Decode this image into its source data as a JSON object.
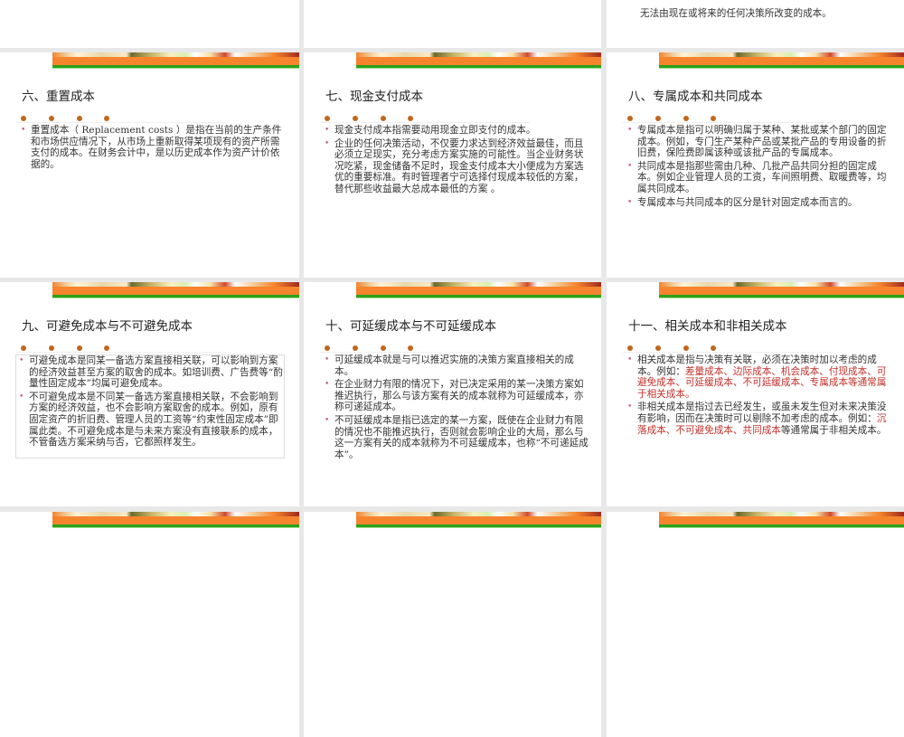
{
  "top_row": {
    "partial_text": "无法由现在或将来的任何决策所改变的成本。"
  },
  "slides": [
    {
      "title": "六、重置成本",
      "boxed": false,
      "bullets": [
        [
          {
            "text": "重置成本（ Replacement costs ）是指在当前的生产条件和市场供应情况下，从市场上重新取得某项现有的资产所需支付的成本。在财务会计中，是以历史成本作为资产计价依据的。",
            "red": false
          }
        ]
      ]
    },
    {
      "title": "七、现金支付成本",
      "boxed": false,
      "bullets": [
        [
          {
            "text": "现金支付成本指需要动用现金立即支付的成本。",
            "red": false
          }
        ],
        [
          {
            "text": "企业的任何决策活动，不仅要力求达到经济效益最佳，而且必须立足现实，充分考虑方案实施的可能性。当企业财务状况吃紧，现金储备不足时，现金支付成本大小便成为方案选优的重要标准。有时管理者宁可选择付现成本较低的方案，替代那些收益最大总成本最低的方案 。",
            "red": false
          }
        ]
      ]
    },
    {
      "title": "八、专属成本和共同成本",
      "boxed": false,
      "bullets": [
        [
          {
            "text": "专属成本是指可以明确归属于某种、某批或某个部门的固定成本。例如，专门生产某种产品或某批产品的专用设备的折旧费，保险费即属该种或该批产品的专属成本。",
            "red": false
          }
        ],
        [
          {
            "text": "共同成本是指那些需由几种、几批产品共同分担的固定成本。例如企业管理人员的工资，车间照明费、取暖费等，均属共同成本。",
            "red": false
          }
        ],
        [
          {
            "text": "专属成本与共同成本的区分是针对固定成本而言的。",
            "red": false
          }
        ]
      ]
    },
    {
      "title": "九、可避免成本与不可避免成本",
      "boxed": true,
      "bullets": [
        [
          {
            "text": "可避免成本是同某一备选方案直接相关联，可以影响到方案的经济效益甚至方案的取舍的成本。如培训费、广告费等“酌量性固定成本”均属可避免成本。",
            "red": false
          }
        ],
        [
          {
            "text": "不可避免成本是不同某一备选方案直接相关联，不会影响到方案的经济效益，也不会影响方案取舍的成本。例如，原有固定资产的折旧费、管理人员的工资等“约束性固定成本”即属此类。不可避免成本是与未来方案没有直接联系的成本，不管备选方案采纳与否，它都照样发生。",
            "red": false
          }
        ]
      ]
    },
    {
      "title": "十、可延缓成本与不可延缓成本",
      "boxed": false,
      "bullets": [
        [
          {
            "text": "可延缓成本就是与可以推迟实施的决策方案直接相关的成本。",
            "red": false
          }
        ],
        [
          {
            "text": "在企业财力有限的情况下，对已决定采用的某一决策方案如推迟执行，那么与该方案有关的成本就称为可延缓成本，亦称可递延成本。",
            "red": false
          }
        ],
        [
          {
            "text": "不可延缓成本是指已选定的某一方案，既使在企业财力有限的情况也不能推迟执行，否则就会影响企业的大局，那么与这一方案有关的成本就称为不可延缓成本，也称“不可递延成本”。",
            "red": false
          }
        ]
      ]
    },
    {
      "title": "十一、相关成本和非相关成本",
      "boxed": false,
      "bullets": [
        [
          {
            "text": "相关成本是指与决策有关联，必须在决策时加以考虑的成本。例如：",
            "red": false
          },
          {
            "text": "差量成本、边际成本、机会成本、付现成本、可避免成本、可延缓成本、不可延缓成本、专属成本等通常属于相关成本。",
            "red": true
          }
        ],
        [
          {
            "text": "非相关成本是指过去已经发生，或虽未发生但对未来决策没有影响，因而在决策时可以剔除不加考虑的成本。例如：",
            "red": false
          },
          {
            "text": "沉落成本、不可避免成本、共同成本",
            "red": true
          },
          {
            "text": "等通常属于非相关成本。",
            "red": false
          }
        ]
      ]
    }
  ]
}
